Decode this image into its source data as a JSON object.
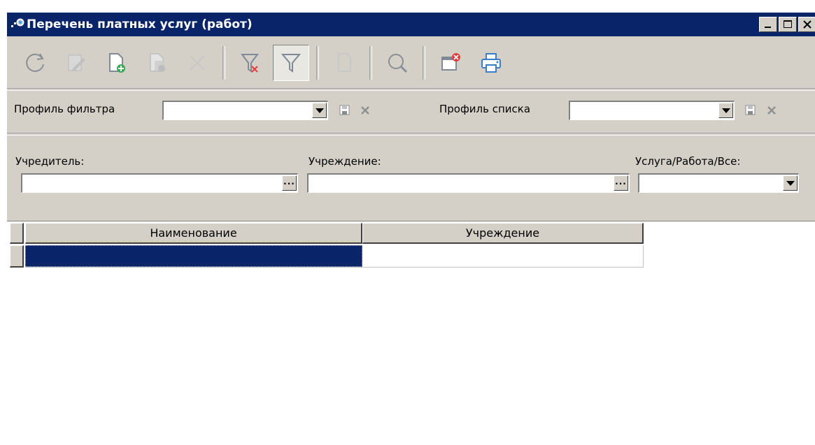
{
  "window": {
    "title": "Перечень платных услуг (работ)"
  },
  "toolbar": {
    "buttons": [
      {
        "icon": "refresh-icon"
      },
      {
        "icon": "edit-icon"
      },
      {
        "icon": "new-document-icon"
      },
      {
        "icon": "copy-document-icon"
      },
      {
        "icon": "delete-icon"
      },
      {
        "icon": "clear-filter-icon"
      },
      {
        "icon": "filter-icon"
      },
      {
        "icon": "document-icon"
      },
      {
        "icon": "search-icon"
      },
      {
        "icon": "close-window-icon"
      },
      {
        "icon": "print-icon"
      }
    ]
  },
  "profiles": {
    "filter_label": "Профиль фильтра",
    "filter_value": "",
    "list_label": "Профиль списка",
    "list_value": ""
  },
  "filters": {
    "founder_label": "Учредитель:",
    "founder_value": "",
    "institution_label": "Учреждение:",
    "institution_value": "",
    "type_label": "Услуга/Работа/Все:",
    "type_value": ""
  },
  "grid": {
    "columns": [
      "Наименование",
      "Учреждение"
    ],
    "rows": [
      [
        "",
        ""
      ]
    ],
    "selection_color": "#0a246a"
  }
}
